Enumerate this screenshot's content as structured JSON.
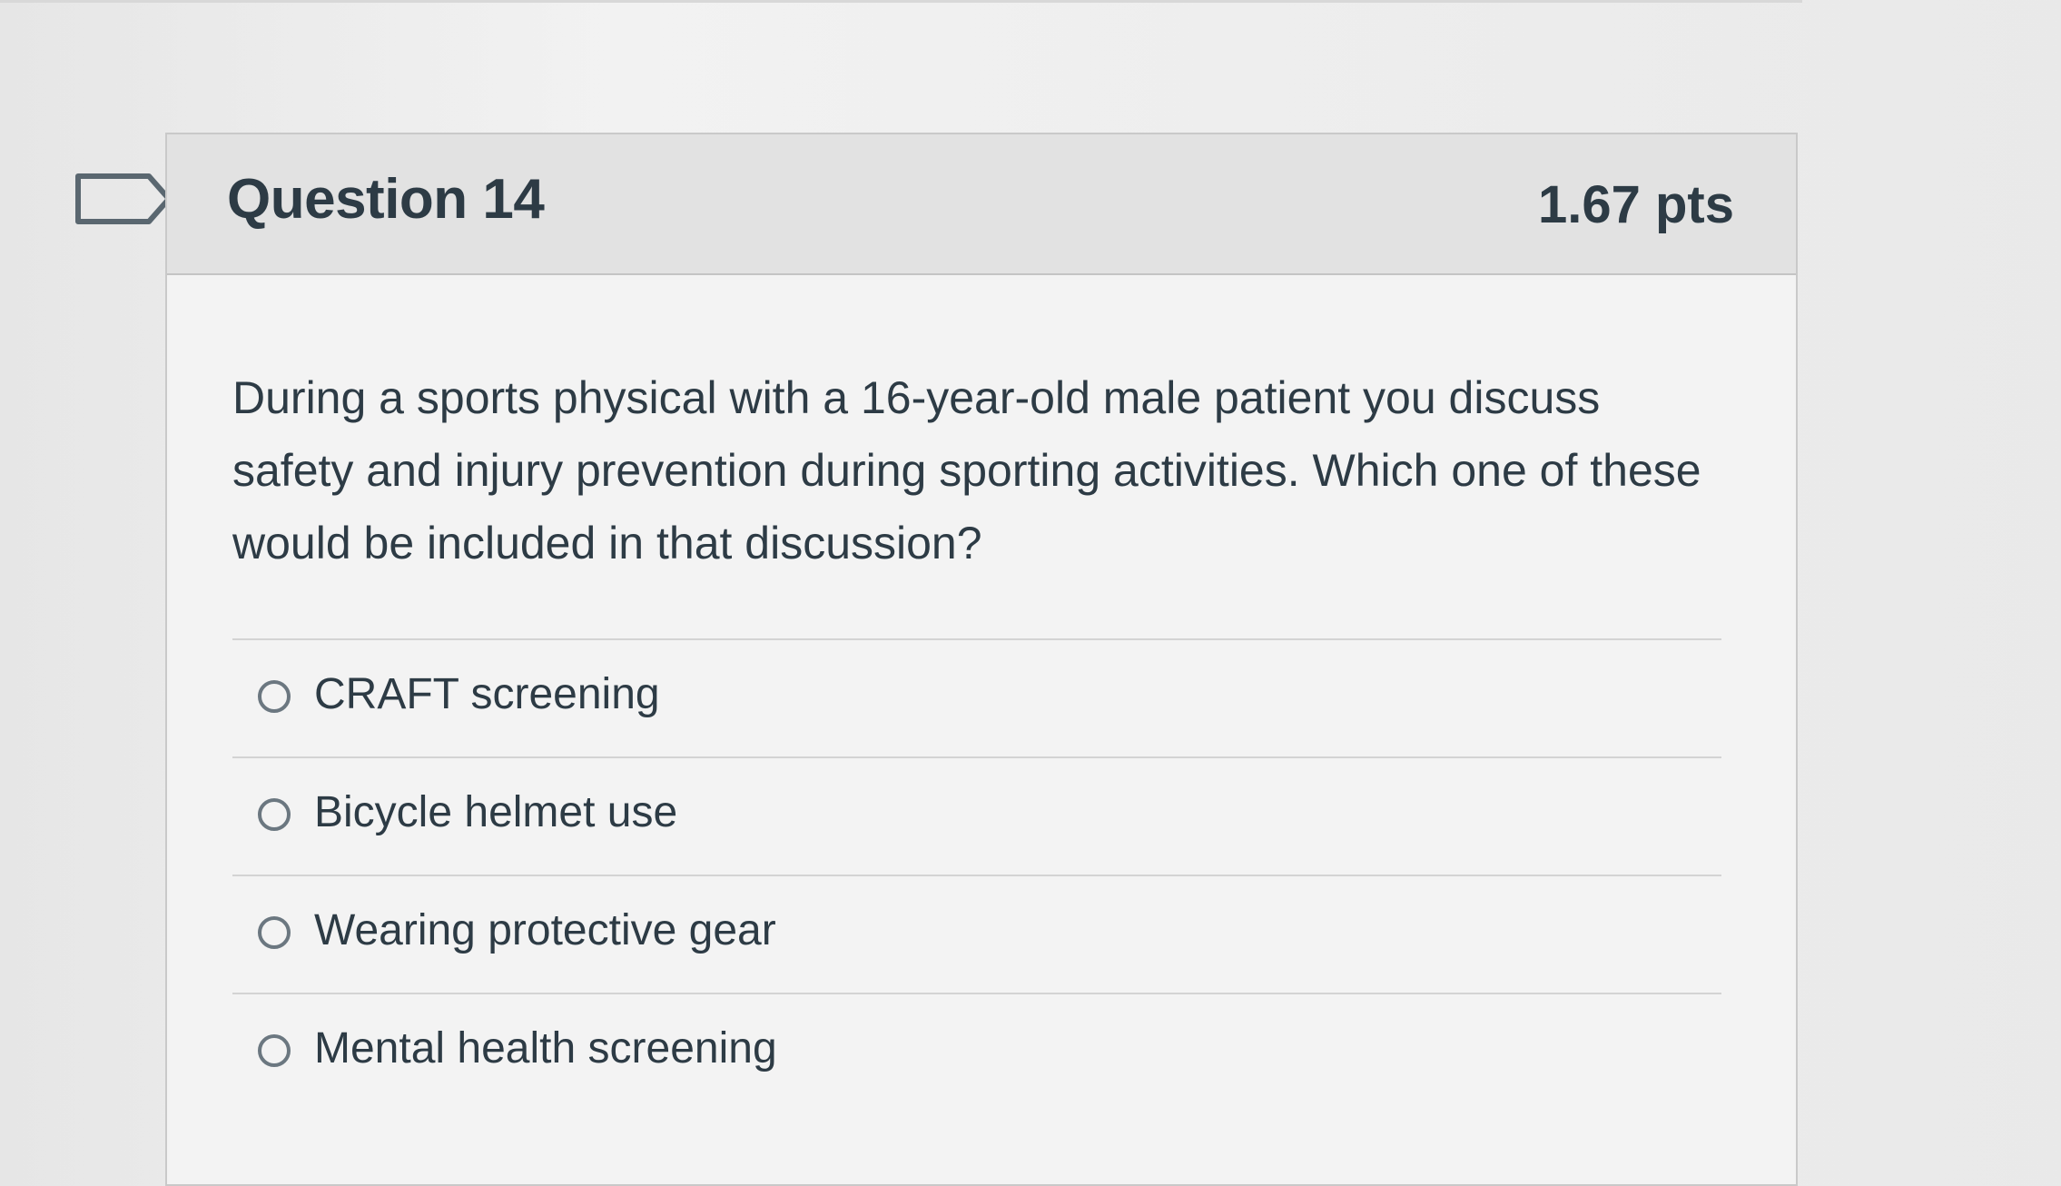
{
  "question": {
    "title": "Question 14",
    "points": "1.67 pts",
    "text": "During a sports physical with a 16-year-old male patient you discuss safety and injury prevention during sporting activities. Which one of these would be included in that discussion?"
  },
  "answers": [
    {
      "label": "CRAFT screening"
    },
    {
      "label": "Bicycle helmet use"
    },
    {
      "label": "Wearing protective gear"
    },
    {
      "label": "Mental health screening"
    }
  ],
  "icons": {
    "flag": "bookmark-flag-icon",
    "radio": "radio-unselected-icon"
  },
  "colors": {
    "text": "#2d3b45",
    "header_bg": "#e2e2e2",
    "card_border": "#c9c9c9"
  }
}
